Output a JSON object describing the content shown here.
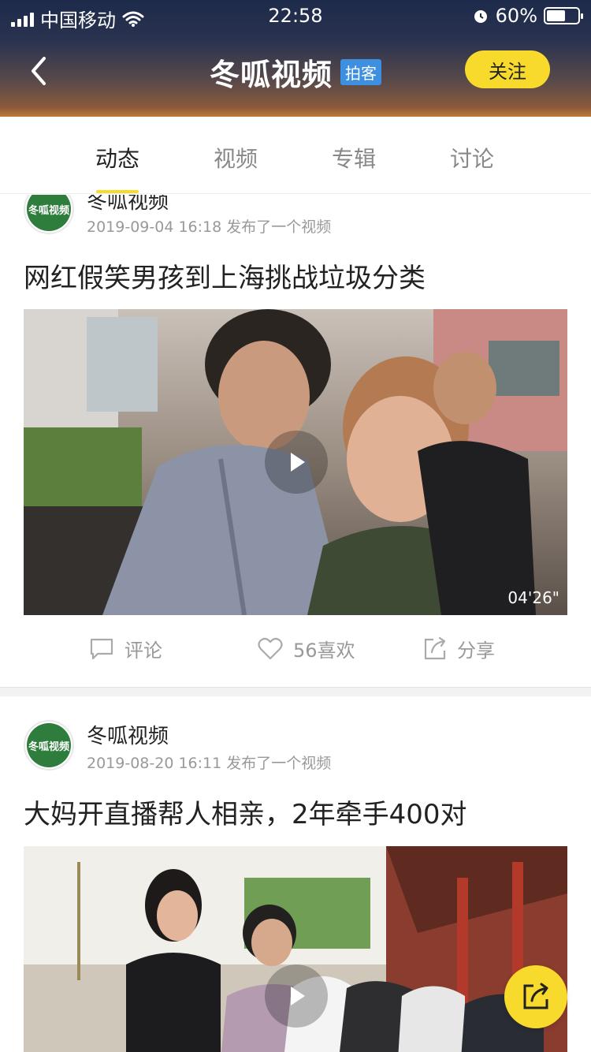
{
  "status_bar": {
    "carrier": "中国移动",
    "time": "22:58",
    "battery": "60%",
    "battery_level": 0.6
  },
  "header": {
    "title": "冬呱视频",
    "tag": "拍客",
    "follow_label": "关注"
  },
  "tabs": [
    {
      "label": "动态",
      "active": true
    },
    {
      "label": "视频",
      "active": false
    },
    {
      "label": "专辑",
      "active": false
    },
    {
      "label": "讨论",
      "active": false
    }
  ],
  "posts": [
    {
      "author": "冬呱视频",
      "avatar_text": "冬呱视频",
      "meta": "2019-09-04 16:18 发布了一个视频",
      "title": "网红假笑男孩到上海挑战垃圾分类",
      "duration": "04'26\"",
      "actions": {
        "comment": "评论",
        "like": "56喜欢",
        "share": "分享"
      }
    },
    {
      "author": "冬呱视频",
      "avatar_text": "冬呱视频",
      "meta": "2019-08-20 16:11 发布了一个视频",
      "title": "大妈开直播帮人相亲，2年牵手400对"
    }
  ],
  "colors": {
    "accent": "#f8da2c",
    "brand_tag": "#3d8fe0",
    "avatar_green": "#2f7d3d"
  }
}
